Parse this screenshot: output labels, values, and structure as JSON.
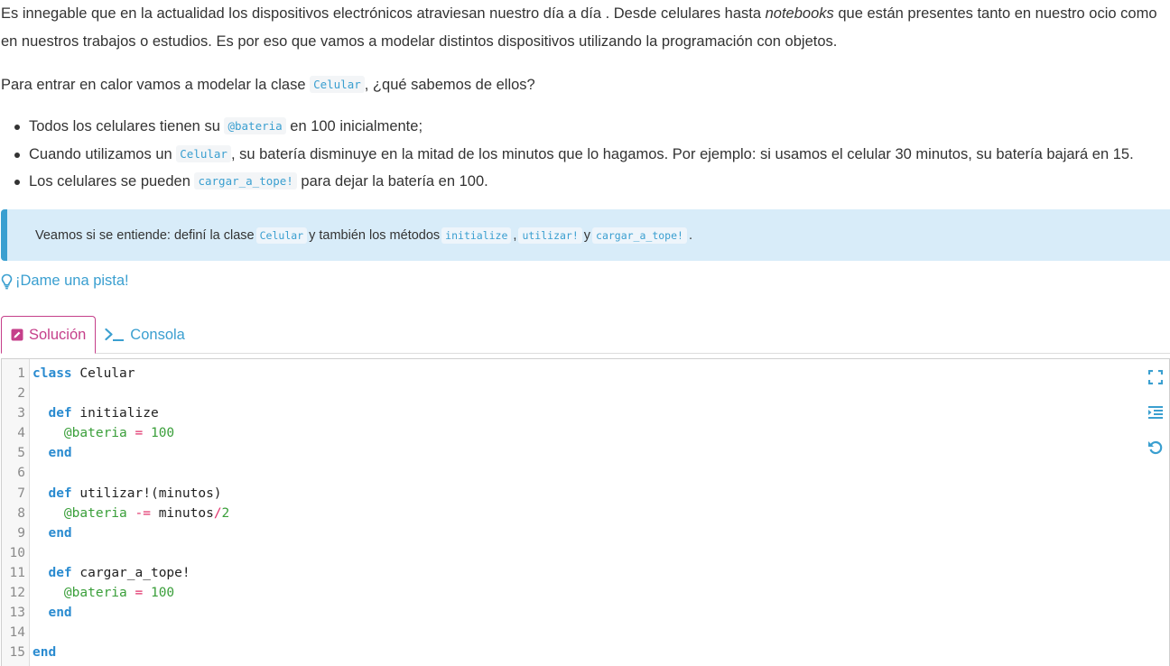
{
  "intro": {
    "p1_part1": "Es innegable que en la actualidad los dispositivos electrónicos atraviesan nuestro día a día . Desde celulares hasta ",
    "p1_em": "notebooks",
    "p1_part2": " que están presentes tanto en nuestro ocio como en nuestros trabajos o estudios. Es por eso que vamos a modelar distintos dispositivos utilizando la programación con objetos.",
    "p2_before": "Para entrar en calor vamos a modelar la clase ",
    "p2_code": "Celular",
    "p2_after": ", ¿qué sabemos de ellos?"
  },
  "bullets": [
    {
      "before": "Todos los celulares tienen su ",
      "code": "@bateria",
      "after": " en 100 inicialmente;"
    },
    {
      "before": "Cuando utilizamos un ",
      "code": "Celular",
      "after": ", su batería disminuye en la mitad de los minutos que lo hagamos. Por ejemplo: si usamos el celular 30 minutos, su batería bajará en 15."
    },
    {
      "before": "Los celulares se pueden ",
      "code": "cargar_a_tope!",
      "after": " para dejar la batería en 100."
    }
  ],
  "callout": {
    "t1": "Veamos si se entiende: definí la clase ",
    "c1": "Celular",
    "t2": " y también los métodos ",
    "c2": "initialize",
    "t3": ", ",
    "c3": "utilizar!",
    "t4": " y ",
    "c4": "cargar_a_tope!",
    "t5": "."
  },
  "hint": {
    "label": "¡Dame una pista!"
  },
  "tabs": {
    "solution": "Solución",
    "console": "Consola"
  },
  "editor": {
    "line_numbers": [
      "1",
      "2",
      "3",
      "4",
      "5",
      "6",
      "7",
      "8",
      "9",
      "10",
      "11",
      "12",
      "13",
      "14",
      "15"
    ],
    "code": {
      "l1_kw": "class",
      "l1_rest": " Celular",
      "l3_kw": "def",
      "l3_rest": " initialize",
      "l4_ivar": "@bateria",
      "l4_op": "=",
      "l4_num": "100",
      "l5_kw": "end",
      "l7_kw": "def",
      "l7_rest": " utilizar!(minutos)",
      "l8_ivar": "@bateria",
      "l8_op": "-=",
      "l8_var": "minutos",
      "l8_op2": "/",
      "l8_num": "2",
      "l9_kw": "end",
      "l11_kw": "def",
      "l11_rest": " cargar_a_tope!",
      "l12_ivar": "@bateria",
      "l12_op": "=",
      "l12_num": "100",
      "l13_kw": "end",
      "l15_kw": "end"
    }
  },
  "colors": {
    "accent_blue": "#3a9fd0",
    "accent_pink": "#c53f8a",
    "callout_bg": "#d8ecf9"
  }
}
